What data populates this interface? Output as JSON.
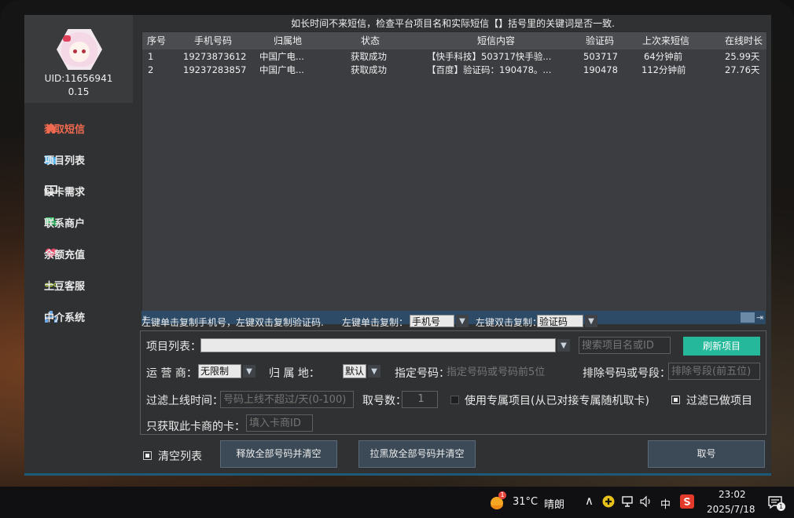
{
  "profile": {
    "uid": "UID:11656941",
    "balance": "0.15"
  },
  "nav": [
    {
      "label": "获取短信",
      "icon": "home-icon",
      "active": true
    },
    {
      "label": "项目列表",
      "icon": "folder-icon"
    },
    {
      "label": "缺卡需求",
      "icon": "monitor-icon"
    },
    {
      "label": "联系商户",
      "icon": "chat-icon"
    },
    {
      "label": "余额充值",
      "icon": "heart-icon"
    },
    {
      "label": "土豆客服",
      "icon": "dots-icon"
    },
    {
      "label": "中介系统",
      "icon": "network-icon"
    }
  ],
  "notice": "如长时间不来短信，检查平台项目名和实际短信【】括号里的关键词是否一致.",
  "table": {
    "headers": [
      "序号",
      "手机号码",
      "归属地",
      "状态",
      "短信内容",
      "验证码",
      "上次来短信",
      "在线时长"
    ],
    "rows": [
      [
        "1",
        "19273873612",
        "中国广电...",
        "获取成功",
        "【快手科技】503717快手验...",
        "503717",
        "64分钟前",
        "25.99天"
      ],
      [
        "2",
        "19237283857",
        "中国广电...",
        "获取成功",
        "【百度】验证码：190478。...",
        "190478",
        "112分钟前",
        "27.76天"
      ]
    ]
  },
  "copy": {
    "hint": "左键单击复制手机号，左键双击复制验证码.",
    "single_label": "左键单击复制：",
    "single_value": "手机号",
    "double_label": "左键双击复制：",
    "double_value": "验证码"
  },
  "form": {
    "project_label": "项目列表：",
    "project_value": "",
    "search_placeholder": "搜索项目名或ID",
    "refresh_label": "刷新项目",
    "operator_label": "运 营 商：",
    "operator_value": "无限制",
    "region_label": "归 属 地：",
    "region_value": "默认",
    "number_label": "指定号码：",
    "number_placeholder": "指定号码或号码前5位",
    "exclude_label": "排除号码或号段：",
    "exclude_placeholder": "排除号段(前五位)",
    "online_label": "过滤上线时间：",
    "online_placeholder": "号码上线不超过/天(0-100)",
    "count_label": "取号数：",
    "count_value": "1",
    "dedicated_label": "使用专属项目(从已对接专属随机取卡)",
    "filter_done_label": "过滤已做项目",
    "card_only_label": "只获取此卡商的卡：",
    "card_placeholder": "填入卡商ID"
  },
  "actions": {
    "clear_list": "清空列表",
    "release_all": "释放全部号码并清空",
    "blacklist_all": "拉黑放全部号码并清空",
    "get_number": "取号"
  },
  "taskbar": {
    "weather_temp": "31°C",
    "weather_desc": "晴朗",
    "ime": "中",
    "time": "23:02",
    "date": "2025/7/18",
    "notif_count": "1",
    "weather_badge": "1"
  }
}
